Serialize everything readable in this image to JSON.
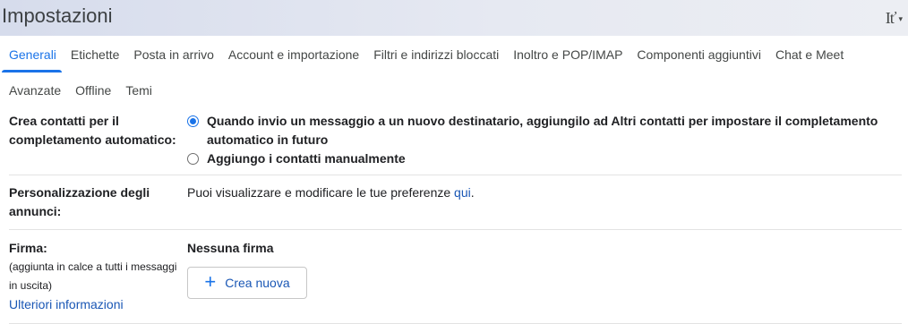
{
  "header": {
    "title": "Impostazioni",
    "input_tools_icon": "input-tools-icon",
    "input_tools_glyph": "Iť",
    "caret_glyph": "▾"
  },
  "tabs": [
    {
      "label": "Generali",
      "active": true
    },
    {
      "label": "Etichette"
    },
    {
      "label": "Posta in arrivo"
    },
    {
      "label": "Account e importazione"
    },
    {
      "label": "Filtri e indirizzi bloccati"
    },
    {
      "label": "Inoltro e POP/IMAP"
    },
    {
      "label": "Componenti aggiuntivi"
    },
    {
      "label": "Chat e Meet"
    },
    {
      "label": "Avanzate"
    },
    {
      "label": "Offline"
    },
    {
      "label": "Temi"
    }
  ],
  "autocomplete": {
    "label": "Crea contatti per il completamento automatico:",
    "option1": "Quando invio un messaggio a un nuovo destinatario, aggiungilo ad Altri contatti per impostare il completamento automatico in futuro",
    "option1_checked": true,
    "option2": "Aggiungo i contatti manualmente",
    "option2_checked": false
  },
  "ads": {
    "label": "Personalizzazione degli annunci:",
    "text": "Puoi visualizzare e modificare le tue preferenze ",
    "link": "qui",
    "period": "."
  },
  "signature": {
    "label": "Firma:",
    "sublabel": "(aggiunta in calce a tutti i messaggi in uscita)",
    "more_info": "Ulteriori informazioni",
    "none": "Nessuna firma",
    "create_label": "Crea nuova",
    "plus_glyph": "+"
  },
  "colors": {
    "accent": "#1a73e8",
    "link": "#1a57b5",
    "header_bg": "#d6dcec"
  }
}
